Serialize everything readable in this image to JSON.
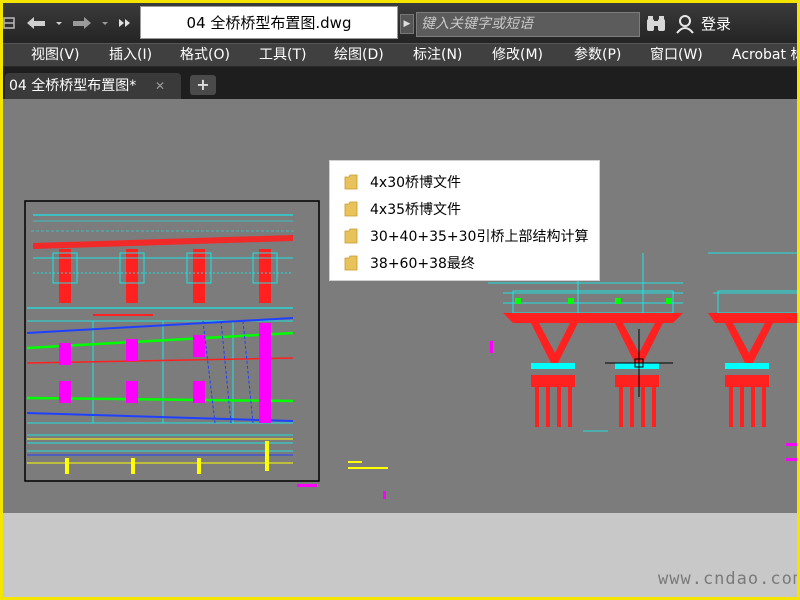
{
  "titlebar": {
    "document_title": "04 全桥桥型布置图.dwg",
    "search_placeholder": "键入关键字或短语",
    "login_label": "登录",
    "quick_access": {
      "undo_icon": "undo-arrow-icon",
      "redo_icon": "redo-arrow-icon",
      "more_icon": "double-chevron-icon",
      "search_expand_icon": "triangle-right-icon",
      "binoculars_icon": "binoculars-icon",
      "user_icon": "user-icon"
    }
  },
  "menu": {
    "items": [
      {
        "label": "视图(V)"
      },
      {
        "label": "插入(I)"
      },
      {
        "label": "格式(O)"
      },
      {
        "label": "工具(T)"
      },
      {
        "label": "绘图(D)"
      },
      {
        "label": "标注(N)"
      },
      {
        "label": "修改(M)"
      },
      {
        "label": "参数(P)"
      },
      {
        "label": "窗口(W)"
      },
      {
        "label": "Acrobat 标"
      }
    ]
  },
  "tabs": {
    "active_label": "04 全桥桥型布置图*",
    "close_glyph": "✕",
    "new_tab_glyph": "+"
  },
  "folder_popup": {
    "items": [
      {
        "label": "4x30桥博文件"
      },
      {
        "label": "4x35桥博文件"
      },
      {
        "label": "30+40+35+30引桥上部结构计算"
      },
      {
        "label": "38+60+38最终"
      }
    ],
    "folder_color": "#e8c25a"
  },
  "watermark": "www.cndao.com",
  "colors": {
    "frame_border": "#f4e400",
    "canvas_bg": "#7c7c7c",
    "cad_cyan": "#00ffff",
    "cad_red": "#ff2020",
    "cad_magenta": "#ff00ff",
    "cad_green": "#00ff00",
    "cad_blue": "#2040ff"
  }
}
